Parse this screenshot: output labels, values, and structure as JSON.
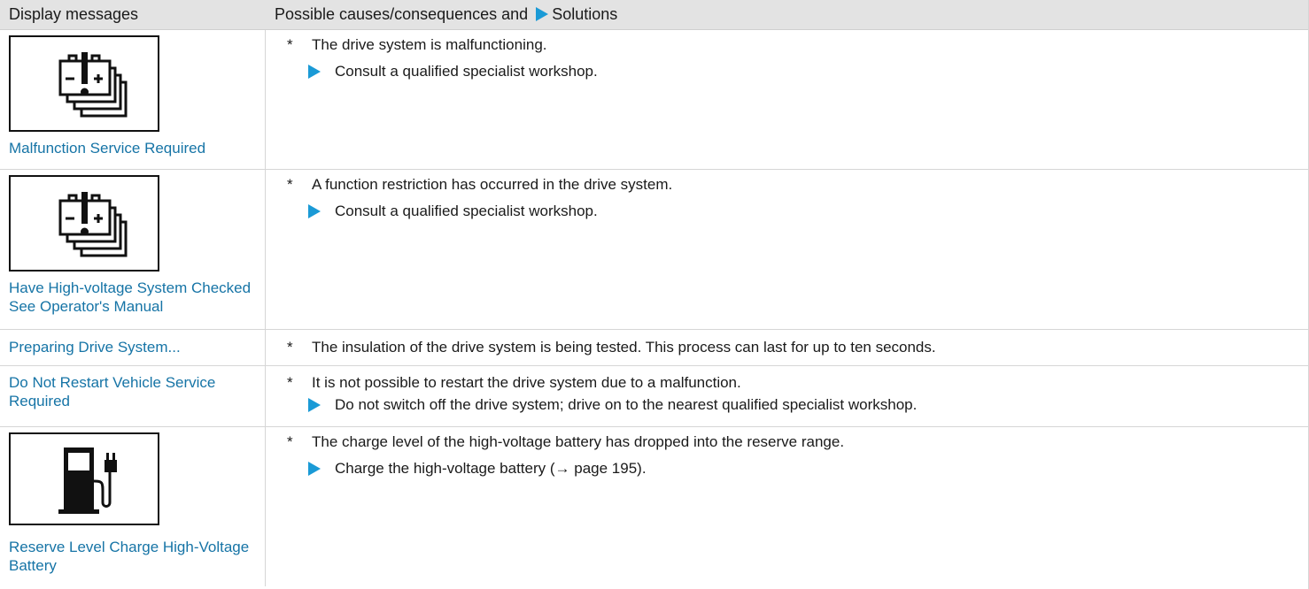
{
  "header": {
    "col1": "Display messages",
    "col2_prefix": "Possible causes/consequences and",
    "col2_suffix": "Solutions"
  },
  "rows": [
    {
      "icon": "battery-warning-icon",
      "message": "Malfunction Service Required",
      "cause": "The drive system is malfunctioning.",
      "solution": "Consult a qualified specialist workshop."
    },
    {
      "icon": "battery-warning-icon",
      "message": "Have High-voltage System Checked See Operator's Manual",
      "cause": "A function restriction has occurred in the drive system.",
      "solution": "Consult a qualified specialist workshop."
    },
    {
      "message": "Preparing Drive System...",
      "cause": "The insulation of the drive system is being tested. This process can last for up to ten seconds."
    },
    {
      "message": "Do Not Restart Vehicle Service Required",
      "cause": "It is not possible to restart the drive system due to a malfunction.",
      "solution": "Do not switch off the drive system; drive on to the nearest qualified specialist workshop."
    },
    {
      "icon": "charging-station-icon",
      "message": "Reserve Level Charge High-Voltage Battery",
      "cause": "The charge level of the high-voltage battery has dropped into the reserve range.",
      "solution": "Charge the high-voltage battery (→ page 195)."
    }
  ],
  "bullet": "*",
  "colors": {
    "link": "#1674a6",
    "triangle": "#1a9ad6",
    "header_bg": "#e3e3e3"
  }
}
